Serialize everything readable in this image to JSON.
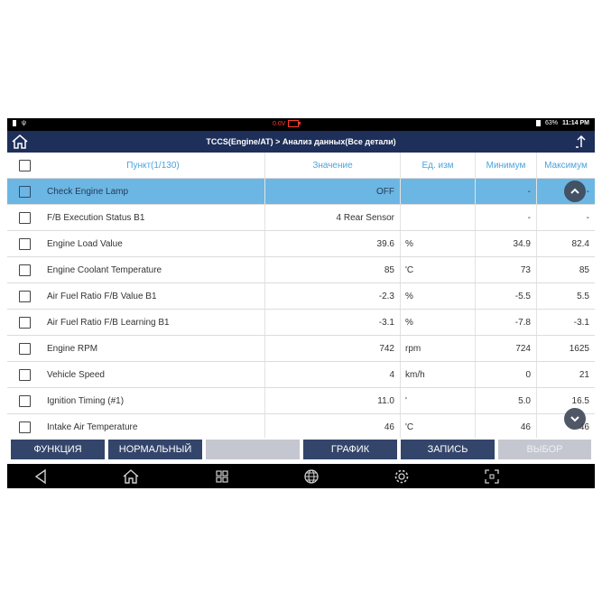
{
  "status_bar": {
    "voltage": "0.0V",
    "battery": "63%",
    "time": "11:14 PM"
  },
  "title_bar": {
    "title": "TCCS(Engine/AT) > Анализ данных(Все детали)"
  },
  "table": {
    "headers": {
      "item": "Пункт(1/130)",
      "value": "Значение",
      "unit": "Ед. изм",
      "min": "Минимум",
      "max": "Максимум"
    },
    "rows": [
      {
        "name": "Check Engine Lamp",
        "value": "OFF",
        "unit": "",
        "min": "-",
        "max": "-",
        "selected": true
      },
      {
        "name": "F/B Execution Status B1",
        "value": "4 Rear Sensor",
        "unit": "",
        "min": "-",
        "max": "-"
      },
      {
        "name": "Engine Load Value",
        "value": "39.6",
        "unit": "%",
        "min": "34.9",
        "max": "82.4"
      },
      {
        "name": "Engine Coolant Temperature",
        "value": "85",
        "unit": "'C",
        "min": "73",
        "max": "85"
      },
      {
        "name": "Air Fuel Ratio F/B Value B1",
        "value": "-2.3",
        "unit": "%",
        "min": "-5.5",
        "max": "5.5"
      },
      {
        "name": "Air Fuel Ratio F/B Learning B1",
        "value": "-3.1",
        "unit": "%",
        "min": "-7.8",
        "max": "-3.1"
      },
      {
        "name": "Engine RPM",
        "value": "742",
        "unit": "rpm",
        "min": "724",
        "max": "1625"
      },
      {
        "name": "Vehicle Speed",
        "value": "4",
        "unit": "km/h",
        "min": "0",
        "max": "21"
      },
      {
        "name": "Ignition Timing (#1)",
        "value": "11.0",
        "unit": "'",
        "min": "5.0",
        "max": "16.5"
      },
      {
        "name": "Intake Air Temperature",
        "value": "46",
        "unit": "'C",
        "min": "46",
        "max": "46"
      }
    ]
  },
  "buttons": {
    "function": "ФУНКЦИЯ",
    "normal": "НОРМАЛЬНЫЙ",
    "blank": "",
    "graph": "ГРАФИК",
    "record": "ЗАПИСЬ",
    "select": "ВЫБОР"
  },
  "icons": {
    "back": "back-icon",
    "home": "home-icon",
    "recent": "recent-apps-icon",
    "browser": "globe-icon",
    "settings": "gear-icon",
    "screenshot": "screenshot-icon",
    "scroll_up": "chevron-up-icon",
    "scroll_down": "chevron-down-icon",
    "export": "export-icon"
  },
  "colors": {
    "title_bar": "#1e2f5a",
    "selected_row": "#6cb6e3",
    "button": "#34456b",
    "header_text": "#4aa3df"
  }
}
